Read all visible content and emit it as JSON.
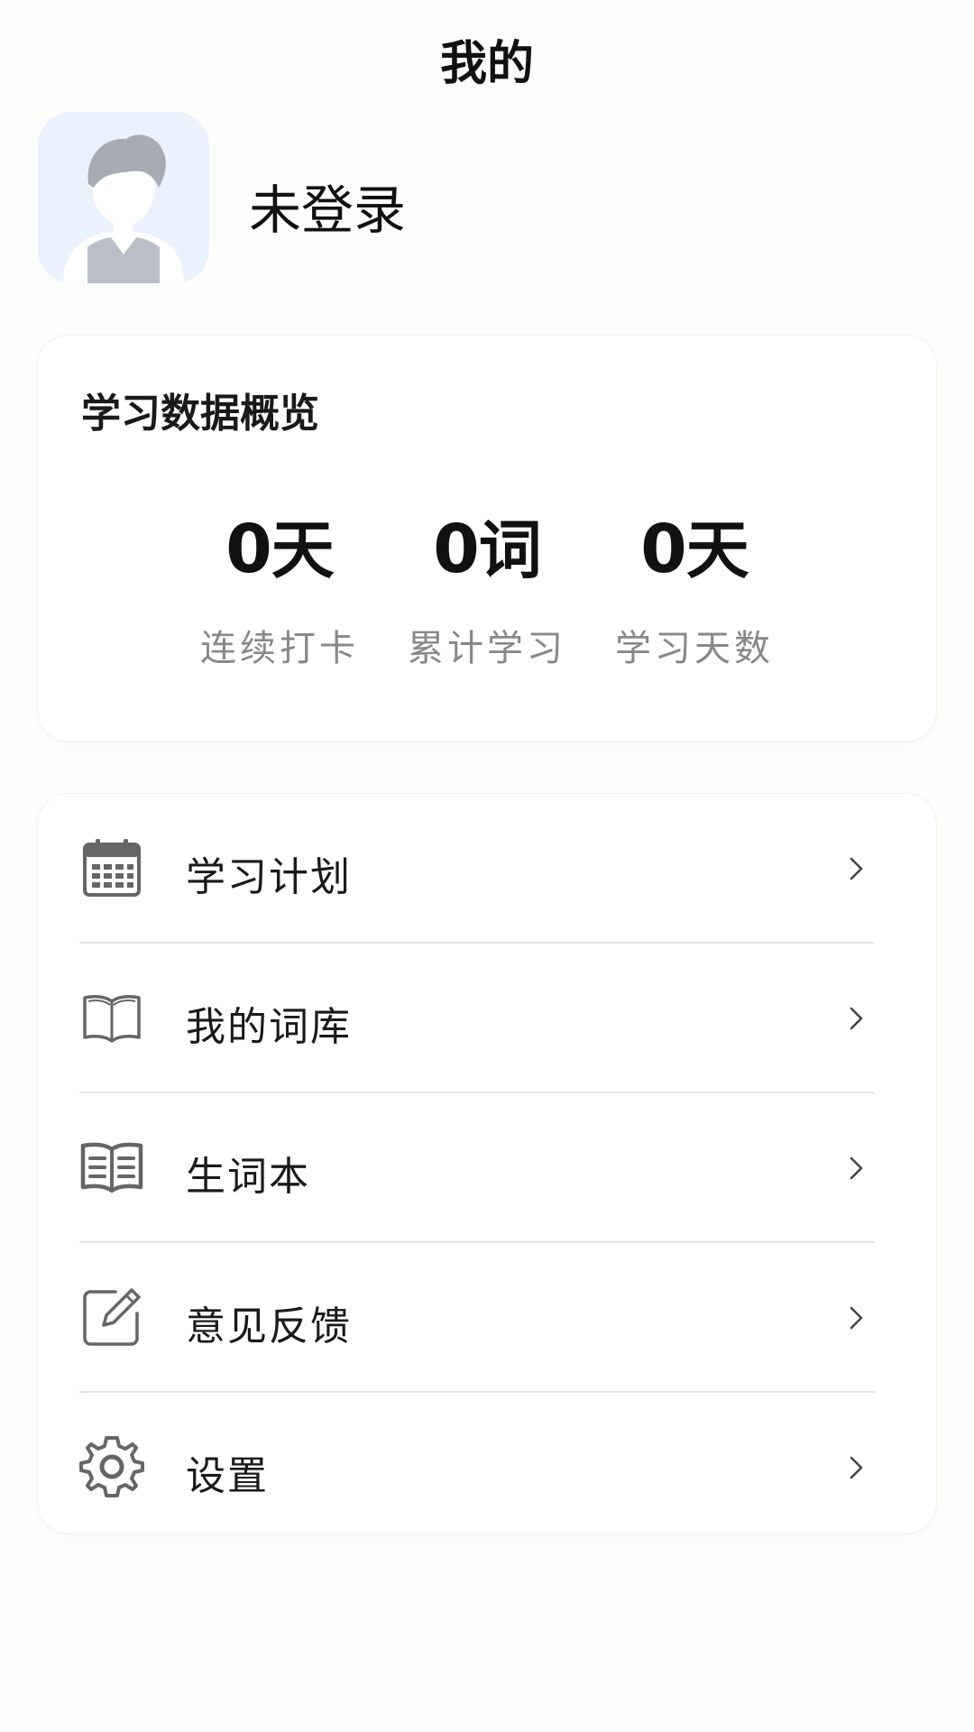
{
  "header": {
    "title": "我的"
  },
  "profile": {
    "avatar_icon": "default-user-avatar",
    "name": "未登录"
  },
  "stats": {
    "title": "学习数据概览",
    "items": [
      {
        "value": "0",
        "unit": "天",
        "label": "连续打卡"
      },
      {
        "value": "0",
        "unit": "词",
        "label": "累计学习"
      },
      {
        "value": "0",
        "unit": "天",
        "label": "学习天数"
      }
    ]
  },
  "menu": {
    "items": [
      {
        "label": "学习计划",
        "icon": "calendar-icon"
      },
      {
        "label": "我的词库",
        "icon": "open-book-icon"
      },
      {
        "label": "生词本",
        "icon": "notebook-icon"
      },
      {
        "label": "意见反馈",
        "icon": "edit-icon"
      },
      {
        "label": "设置",
        "icon": "gear-icon"
      }
    ]
  },
  "colors": {
    "background": "#fdfdfc",
    "card": "#ffffff",
    "avatar_bg": "#eaf2fd",
    "icon": "#666666",
    "secondary_text": "#888888"
  }
}
